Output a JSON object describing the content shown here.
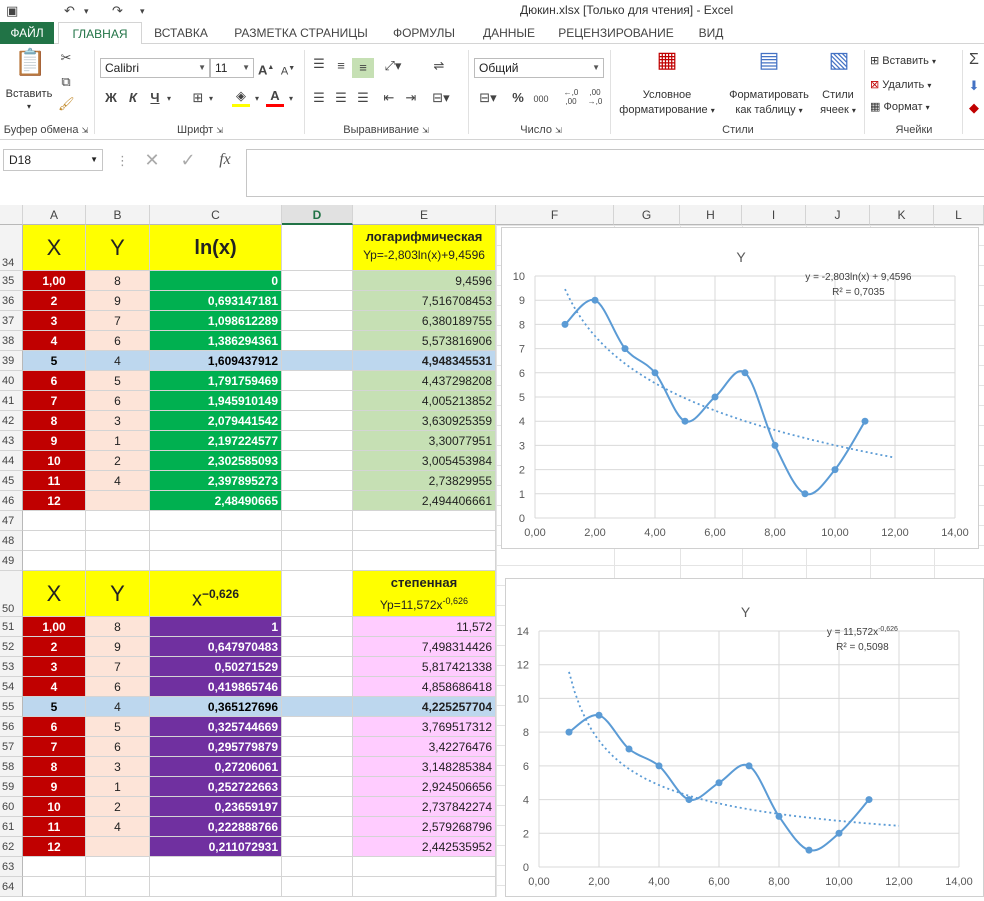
{
  "window": {
    "title": "Дюкин.xlsx  [Только для чтения] - Excel"
  },
  "tabs": [
    "ФАЙЛ",
    "ГЛАВНАЯ",
    "ВСТАВКА",
    "РАЗМЕТКА СТРАНИЦЫ",
    "ФОРМУЛЫ",
    "ДАННЫЕ",
    "РЕЦЕНЗИРОВАНИЕ",
    "ВИД"
  ],
  "ribbon": {
    "paste": "Вставить",
    "clipboard": "Буфер обмена",
    "font_name": "Calibri",
    "font_size": "11",
    "bold": "Ж",
    "italic": "К",
    "underline": "Ч",
    "font_group": "Шрифт",
    "align_group": "Выравнивание",
    "number_format": "Общий",
    "number_group": "Число",
    "cond_format_1": "Условное",
    "cond_format_2": "форматирование",
    "format_table_1": "Форматировать",
    "format_table_2": "как таблицу",
    "styles_1": "Стили",
    "styles_2": "ячеек",
    "styles_group": "Стили",
    "insert": "Вставить",
    "delete": "Удалить",
    "format": "Формат",
    "cells_group": "Ячейки"
  },
  "formula": {
    "namebox": "D18",
    "fx": "fx"
  },
  "columns": [
    "A",
    "B",
    "C",
    "D",
    "E",
    "F",
    "G",
    "H",
    "I",
    "J",
    "K",
    "L"
  ],
  "table1": {
    "header_row": "34",
    "h_x": "X",
    "h_y": "Y",
    "h_c": "ln(x)",
    "h_e1": "логарифмическая",
    "h_e2": "Yp=-2,803ln(x)+9,4596",
    "rows": [
      {
        "r": "35",
        "a": "1,00",
        "b": "8",
        "c": "0",
        "e": "9,4596"
      },
      {
        "r": "36",
        "a": "2",
        "b": "9",
        "c": "0,693147181",
        "e": "7,516708453"
      },
      {
        "r": "37",
        "a": "3",
        "b": "7",
        "c": "1,098612289",
        "e": "6,380189755"
      },
      {
        "r": "38",
        "a": "4",
        "b": "6",
        "c": "1,386294361",
        "e": "5,573816906"
      },
      {
        "r": "39",
        "a": "5",
        "b": "4",
        "c": "1,609437912",
        "e": "4,948345531"
      },
      {
        "r": "40",
        "a": "6",
        "b": "5",
        "c": "1,791759469",
        "e": "4,437298208"
      },
      {
        "r": "41",
        "a": "7",
        "b": "6",
        "c": "1,945910149",
        "e": "4,005213852"
      },
      {
        "r": "42",
        "a": "8",
        "b": "3",
        "c": "2,079441542",
        "e": "3,630925359"
      },
      {
        "r": "43",
        "a": "9",
        "b": "1",
        "c": "2,197224577",
        "e": "3,30077951"
      },
      {
        "r": "44",
        "a": "10",
        "b": "2",
        "c": "2,302585093",
        "e": "3,005453984"
      },
      {
        "r": "45",
        "a": "11",
        "b": "4",
        "c": "2,397895273",
        "e": "2,73829955"
      },
      {
        "r": "46",
        "a": "12",
        "b": "",
        "c": "2,48490665",
        "e": "2,494406661"
      }
    ]
  },
  "blank_rows": [
    "47",
    "48",
    "49"
  ],
  "table2": {
    "header_row": "50",
    "h_x": "X",
    "h_y": "Y",
    "h_c_base": "x",
    "h_c_exp": "−0,626",
    "h_e1": "степенная",
    "h_e2_base": "Yp=11,572x",
    "h_e2_exp": "-0,626",
    "rows": [
      {
        "r": "51",
        "a": "1,00",
        "b": "8",
        "c": "1",
        "e": "11,572"
      },
      {
        "r": "52",
        "a": "2",
        "b": "9",
        "c": "0,647970483",
        "e": "7,498314426"
      },
      {
        "r": "53",
        "a": "3",
        "b": "7",
        "c": "0,50271529",
        "e": "5,817421338"
      },
      {
        "r": "54",
        "a": "4",
        "b": "6",
        "c": "0,419865746",
        "e": "4,858686418"
      },
      {
        "r": "55",
        "a": "5",
        "b": "4",
        "c": "0,365127696",
        "e": "4,225257704"
      },
      {
        "r": "56",
        "a": "6",
        "b": "5",
        "c": "0,325744669",
        "e": "3,769517312"
      },
      {
        "r": "57",
        "a": "7",
        "b": "6",
        "c": "0,295779879",
        "e": "3,42276476"
      },
      {
        "r": "58",
        "a": "8",
        "b": "3",
        "c": "0,27206061",
        "e": "3,148285384"
      },
      {
        "r": "59",
        "a": "9",
        "b": "1",
        "c": "0,252722663",
        "e": "2,924506656"
      },
      {
        "r": "60",
        "a": "10",
        "b": "2",
        "c": "0,23659197",
        "e": "2,737842274"
      },
      {
        "r": "61",
        "a": "11",
        "b": "4",
        "c": "0,222888766",
        "e": "2,579268796"
      },
      {
        "r": "62",
        "a": "12",
        "b": "",
        "c": "0,211072931",
        "e": "2,442535952"
      }
    ],
    "after_rows": [
      "63",
      "64"
    ]
  },
  "colors": {
    "green": "#00b050",
    "red": "#c00000",
    "purple": "#7030a0",
    "yellow": "#ffff00",
    "peach": "#fde4d8",
    "lightgreen": "#c6e0b4",
    "pink": "#ffccff",
    "selrow": "#bdd7ee",
    "series": "#5b9bd5"
  },
  "chart_data": [
    {
      "type": "scatter",
      "title": "Y",
      "trend_label": "y = -2,803ln(x) + 9,4596",
      "r2_label": "R² = 0,7035",
      "x": [
        1,
        2,
        3,
        4,
        5,
        6,
        7,
        8,
        9,
        10,
        11
      ],
      "y": [
        8,
        9,
        7,
        6,
        4,
        5,
        6,
        3,
        1,
        2,
        4
      ],
      "xlim": [
        0,
        14
      ],
      "ylim": [
        0,
        10
      ],
      "xticks": [
        "0,00",
        "2,00",
        "4,00",
        "6,00",
        "8,00",
        "10,00",
        "12,00",
        "14,00"
      ],
      "yticks": [
        "0",
        "1",
        "2",
        "3",
        "4",
        "5",
        "6",
        "7",
        "8",
        "9",
        "10"
      ],
      "trend": "log",
      "trend_a": -2.803,
      "trend_b": 9.4596,
      "trend_range": [
        1,
        12
      ]
    },
    {
      "type": "scatter",
      "title": "Y",
      "trend_label": "y = 11,572x",
      "trend_label_exp": "-0,626",
      "r2_label": "R² = 0,5098",
      "x": [
        1,
        2,
        3,
        4,
        5,
        6,
        7,
        8,
        9,
        10,
        11
      ],
      "y": [
        8,
        9,
        7,
        6,
        4,
        5,
        6,
        3,
        1,
        2,
        4
      ],
      "xlim": [
        0,
        14
      ],
      "ylim": [
        0,
        14
      ],
      "xticks": [
        "0,00",
        "2,00",
        "4,00",
        "6,00",
        "8,00",
        "10,00",
        "12,00",
        "14,00"
      ],
      "yticks": [
        "0",
        "2",
        "4",
        "6",
        "8",
        "10",
        "12",
        "14"
      ],
      "trend": "power",
      "trend_a": 11.572,
      "trend_b": -0.626,
      "trend_range": [
        1,
        12
      ]
    }
  ]
}
